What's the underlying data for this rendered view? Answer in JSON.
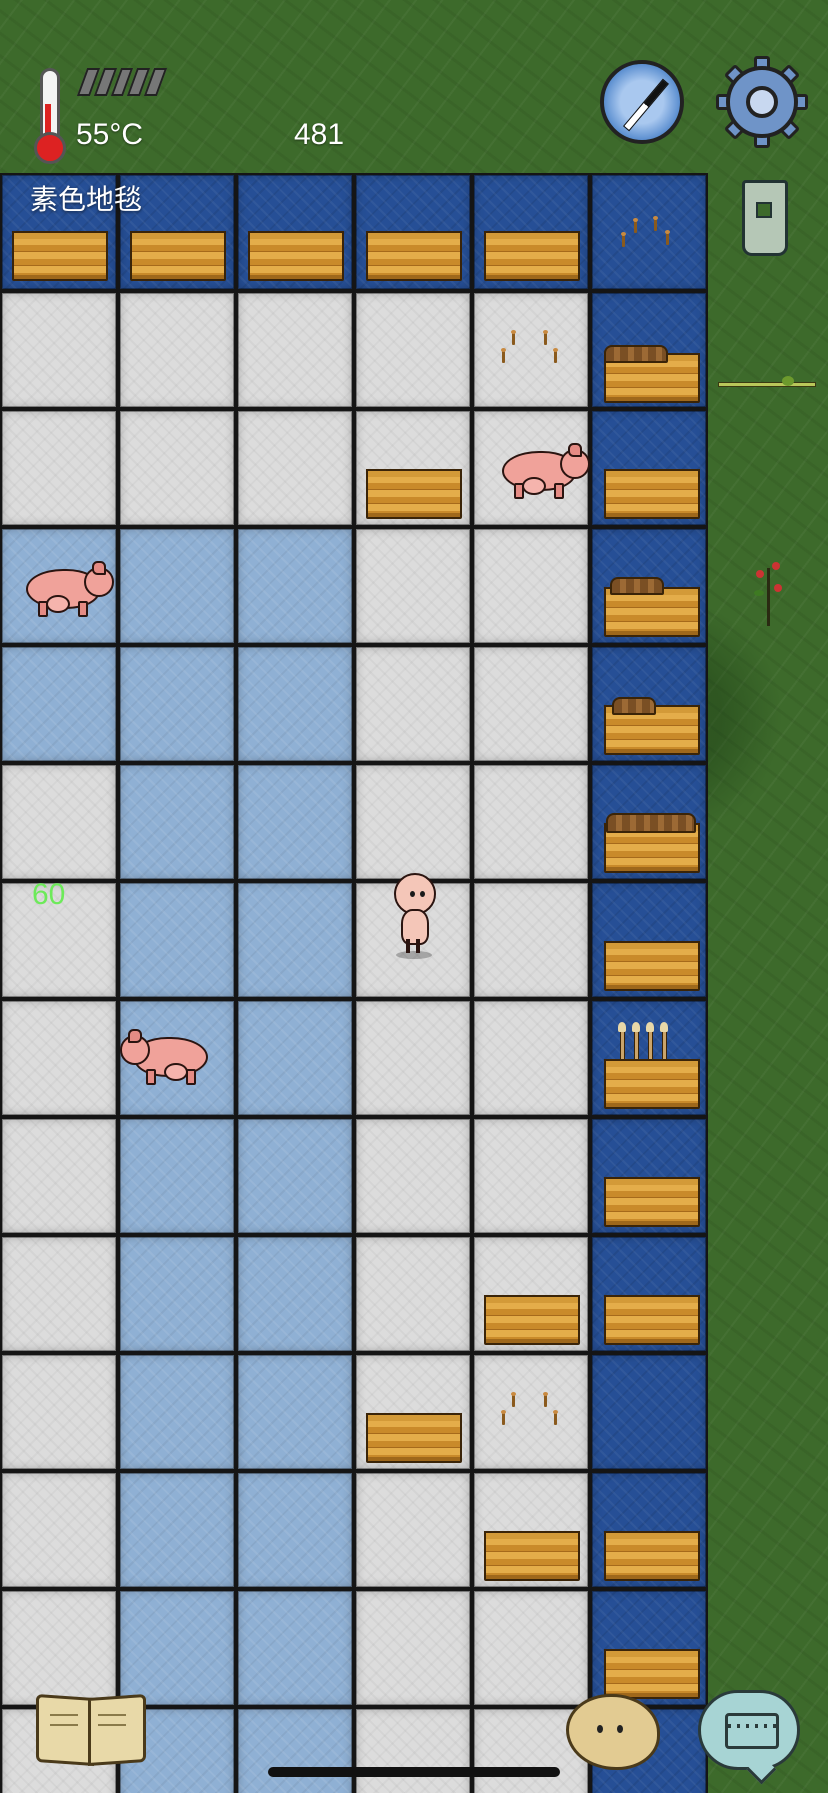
{
  "hud": {
    "temperature_label": "55°C",
    "score": "481",
    "battery_level": 0,
    "thermometer_icon": "thermometer-icon",
    "compass_icon": "compass-icon",
    "settings_icon": "gear-icon",
    "coin_icon": "spade-coin-icon"
  },
  "tile_name": "素色地毯",
  "floating_number": "60",
  "colors": {
    "carpet_white": "#dcdcdc",
    "carpet_light_blue": "#8fb0d4",
    "carpet_dark_blue": "#264f96",
    "grass": "#3d6a2b",
    "floating_number": "#6dea5a"
  },
  "bottom_bar": {
    "book_icon": "recipe-book-icon",
    "emote_icon": "emote-potato-icon",
    "keyboard_icon": "chat-keyboard-icon"
  }
}
